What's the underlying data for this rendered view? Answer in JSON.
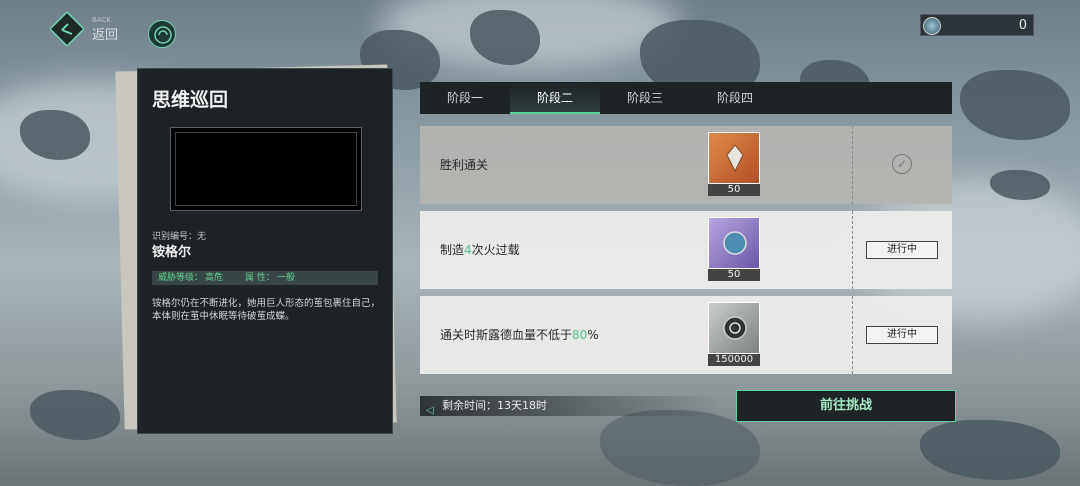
{
  "header": {
    "back_en": "BACK",
    "back_zh": "返回",
    "currency_amount": "0"
  },
  "card": {
    "title": "思维巡回",
    "id_label": "识别编号：无",
    "name": "铵格尔",
    "threat_key": "威胁等级：",
    "threat_value": "高危",
    "attr_key": "属 性：",
    "attr_value": "一般",
    "description": "铵格尔仍在不断进化，她用巨人形态的茧包裹住自己，本体则在茧中休眠等待破茧成蝶。"
  },
  "tabs": [
    {
      "label": "阶段一"
    },
    {
      "label": "阶段二"
    },
    {
      "label": "阶段三"
    },
    {
      "label": "阶段四"
    }
  ],
  "tasks": [
    {
      "label_pre": "胜利通关",
      "label_hl": "",
      "label_post": "",
      "reward_count": "50",
      "status": "",
      "completed": true,
      "reward_icon": "crystal-icon"
    },
    {
      "label_pre": "制造",
      "label_hl": "4",
      "label_post": "次火过载",
      "reward_count": "50",
      "status": "进行中",
      "completed": false,
      "reward_icon": "orb-icon"
    },
    {
      "label_pre": "通关时斯露德血量不低于",
      "label_hl": "80",
      "label_post": "%",
      "reward_count": "150000",
      "status": "进行中",
      "completed": false,
      "reward_icon": "coin-icon"
    }
  ],
  "footer": {
    "timer": "剩余时间：13天18时",
    "challenge_label": "前往挑战"
  },
  "colors": {
    "accent": "#59d59c",
    "panel": "#1c2225"
  }
}
